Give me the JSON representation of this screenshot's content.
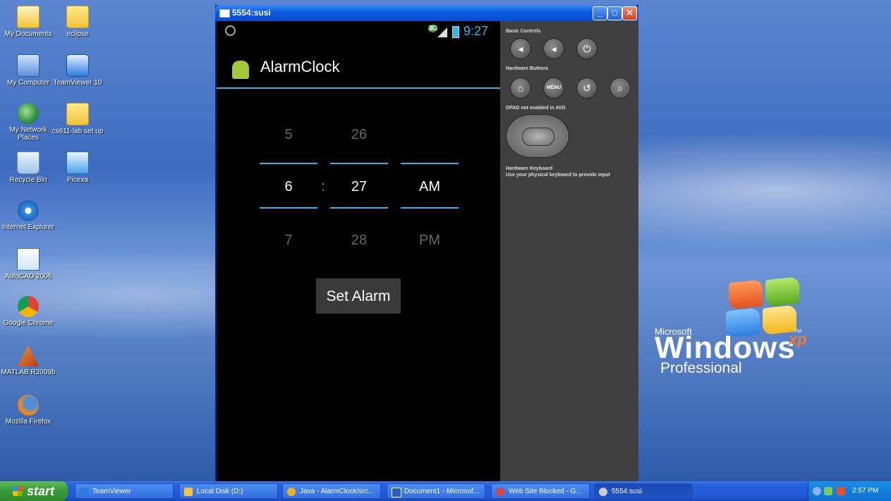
{
  "desktop": {
    "icons": [
      {
        "label": "My Documents",
        "icon": "my-documents-icon"
      },
      {
        "label": "eclipse",
        "icon": "folder-icon"
      },
      {
        "label": "My Computer",
        "icon": "my-computer-icon"
      },
      {
        "label": "TeamViewer 10",
        "icon": "teamviewer-icon"
      },
      {
        "label": "My Network Places",
        "icon": "network-places-icon"
      },
      {
        "label": "cs611-lab set up",
        "icon": "folder-icon"
      },
      {
        "label": "Recycle Bin",
        "icon": "recycle-bin-icon"
      },
      {
        "label": "Picexa",
        "icon": "picexa-icon"
      },
      {
        "label": "Internet Explorer",
        "icon": "internet-explorer-icon"
      },
      {
        "label": "AutoCAD 2006",
        "icon": "autocad-icon"
      },
      {
        "label": "Google Chrome",
        "icon": "chrome-icon"
      },
      {
        "label": "MATLAB R2009b",
        "icon": "matlab-icon"
      },
      {
        "label": "Mozilla Firefox",
        "icon": "firefox-icon"
      }
    ],
    "logo": {
      "microsoft": "Microsoft",
      "windows": "Windows",
      "xp": "xp",
      "tm": "TM",
      "edition": "Professional"
    }
  },
  "emulator": {
    "title": "5554:susi",
    "status_bar": {
      "network": "3G",
      "time": "9:27"
    },
    "app_title": "AlarmClock",
    "picker": {
      "hour": {
        "prev": "5",
        "current": "6",
        "next": "7"
      },
      "separator": ":",
      "minute": {
        "prev": "26",
        "current": "27",
        "next": "28"
      },
      "ampm": {
        "current": "AM",
        "next": "PM"
      }
    },
    "set_alarm_label": "Set Alarm",
    "controls": {
      "basic_label": "Basic Controls",
      "hardware_label": "Hardware Buttons",
      "menu_label": "MENU",
      "dpad_label": "DPAD not enabled in AVD",
      "keyboard_label": "Hardware Keyboard",
      "keyboard_hint": "Use your physical keyboard to provide input"
    }
  },
  "taskbar": {
    "start_label": "start",
    "items": [
      {
        "label": "TeamViewer",
        "color": "#2c7be0"
      },
      {
        "label": "Local Disk (D:)",
        "color": "#f3c338"
      },
      {
        "label": "Java - AlarmClock/src...",
        "color": "#f2b01e"
      },
      {
        "label": "Document1 - Microsof...",
        "color": "#2b5fb8"
      },
      {
        "label": "Web Site Blocked - G...",
        "color": "#db4437"
      },
      {
        "label": "5554:susi",
        "color": "#cccccc"
      }
    ],
    "clock": "2:57 PM"
  }
}
